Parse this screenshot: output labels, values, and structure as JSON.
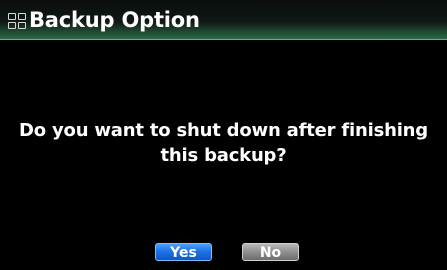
{
  "window": {
    "title": "Backup Option",
    "title_icon": "menu-grid-icon"
  },
  "dialog": {
    "message": "Do you want to shut down after finishing this backup?",
    "buttons": {
      "yes_label": "Yes",
      "no_label": "No"
    },
    "selected_button": "Yes"
  },
  "colors": {
    "background": "#000000",
    "title_bar_accent": "#2b6a48",
    "text": "#ffffff",
    "yes_button": "#1f73e6",
    "no_button": "#8f8f8f"
  }
}
